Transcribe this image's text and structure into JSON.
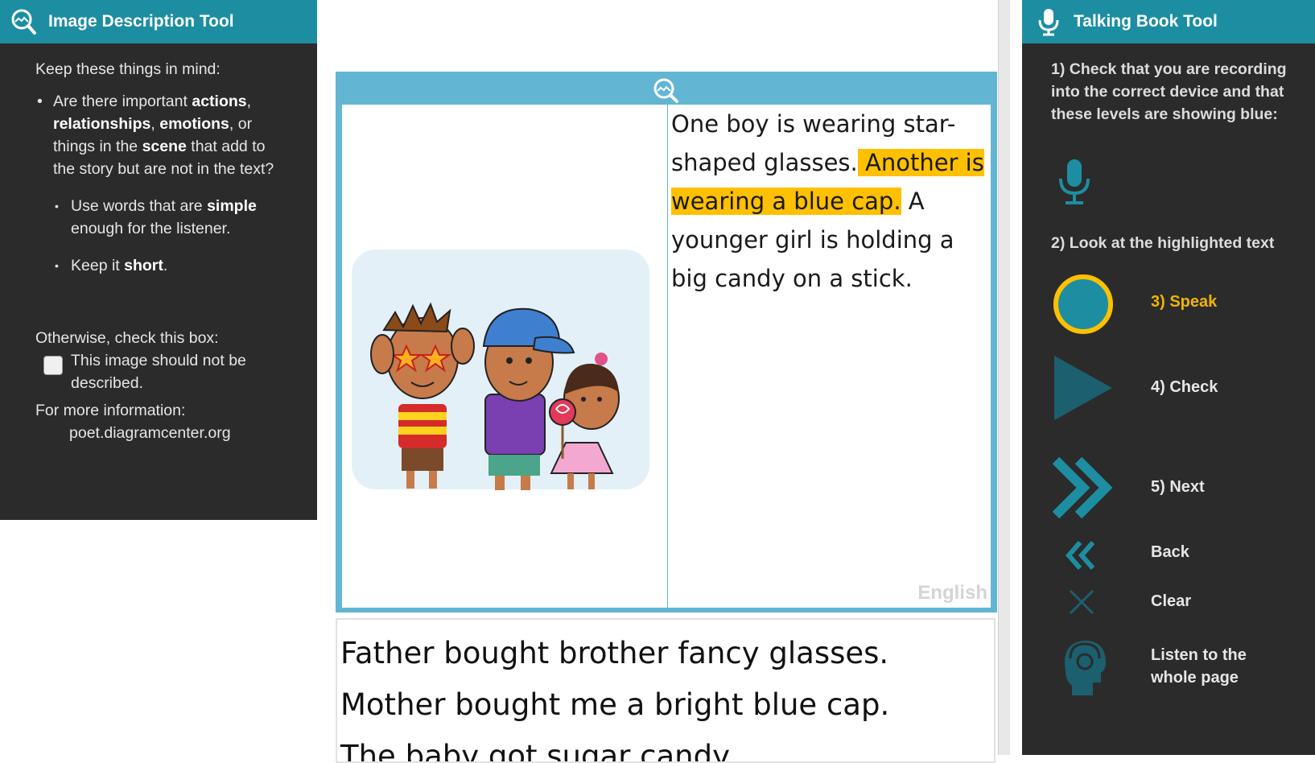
{
  "left_panel": {
    "title": "Image Description Tool",
    "intro": "Keep these things in mind:",
    "bullet1": {
      "t1": "Are there important ",
      "b1": "actions",
      "t2": ", ",
      "b2": "relationships",
      "t3": ", ",
      "b3": "emotions",
      "t4": ", or things in the ",
      "b4": "scene",
      "t5": " that add to the story but are not in the text?"
    },
    "bullet2": {
      "t1": "Use words that are ",
      "b1": "simple",
      "t2": " enough for the listener."
    },
    "bullet3": {
      "t1": "Keep it ",
      "b1": "short",
      "t2": "."
    },
    "otherwise": "Otherwise, check this box:",
    "checkbox_label": "This image should not be described.",
    "more_info": "For more information:",
    "more_url": "poet.diagramcenter.org"
  },
  "center": {
    "description": {
      "s1": "One boy is wearing star-shaped glasses.",
      "s2": " Another is wearing a blue cap.",
      "s3": " A younger girl is holding a big candy on a stick."
    },
    "language": "English",
    "story_lines": [
      "Father bought brother fancy glasses.",
      "Mother bought me a bright blue cap.",
      "The baby got sugar candy."
    ]
  },
  "right_panel": {
    "title": "Talking Book Tool",
    "step1": "1) Check that you are recording into the correct device and that these levels are showing blue:",
    "step2": "2) Look at the highlighted text",
    "speak": "3) Speak",
    "check": "4) Check",
    "next": "5) Next",
    "back": "Back",
    "clear": "Clear",
    "listen": "Listen to the whole page"
  },
  "colors": {
    "header_teal": "#1d8ea1",
    "panel_dark": "#2b2b2b",
    "frame_blue": "#62b5d3",
    "highlight": "#ffc000",
    "speak_label": "#f0b400"
  }
}
